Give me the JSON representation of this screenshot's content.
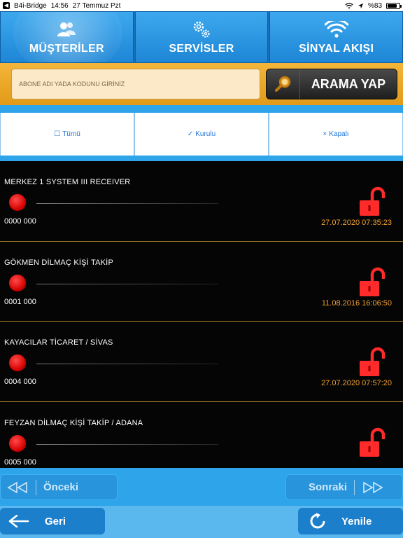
{
  "status_bar": {
    "back_app": "B4i-Bridge",
    "time": "14:56",
    "date": "27 Temmuz Pzt",
    "battery": "%83"
  },
  "tabs": [
    {
      "label": "MÜŞTERİLER",
      "icon": "users-icon",
      "active": true
    },
    {
      "label": "SERVİSLER",
      "icon": "gears-icon",
      "active": false
    },
    {
      "label": "SİNYAL AKIŞI",
      "icon": "wifi-icon",
      "active": false
    }
  ],
  "search": {
    "placeholder": "ABONE ADI YADA KODUNU GİRİNİZ",
    "button_label": "ARAMA YAP"
  },
  "filters": [
    {
      "icon": "☐",
      "label": "Tümü"
    },
    {
      "icon": "✓",
      "label": "Kurulu"
    },
    {
      "icon": "×",
      "label": "Kapalı"
    }
  ],
  "customers": [
    {
      "name": "MERKEZ 1 SYSTEM III RECEIVER",
      "code": "0000 000",
      "date": "27.07.2020 07:35:23"
    },
    {
      "name": "GÖKMEN DİLMAÇ KİŞİ TAKİP",
      "code": "0001 000",
      "date": "11.08.2016 16:06:50"
    },
    {
      "name": "KAYACILAR TİCARET / SİVAS",
      "code": "0004 000",
      "date": "27.07.2020 07:57:20"
    },
    {
      "name": "FEYZAN DİLMAÇ KİŞİ TAKİP / ADANA",
      "code": "0005 000",
      "date": ""
    }
  ],
  "pager": {
    "prev_label": "Önceki",
    "next_label": "Sonraki"
  },
  "bottom_nav": {
    "back_label": "Geri",
    "refresh_label": "Yenile"
  },
  "colors": {
    "status_dot": "#e00000",
    "lock": "#ff2a2a",
    "date": "#f0a030",
    "accent": "#2ea4ea",
    "search_bar": "#f0ae2e"
  }
}
